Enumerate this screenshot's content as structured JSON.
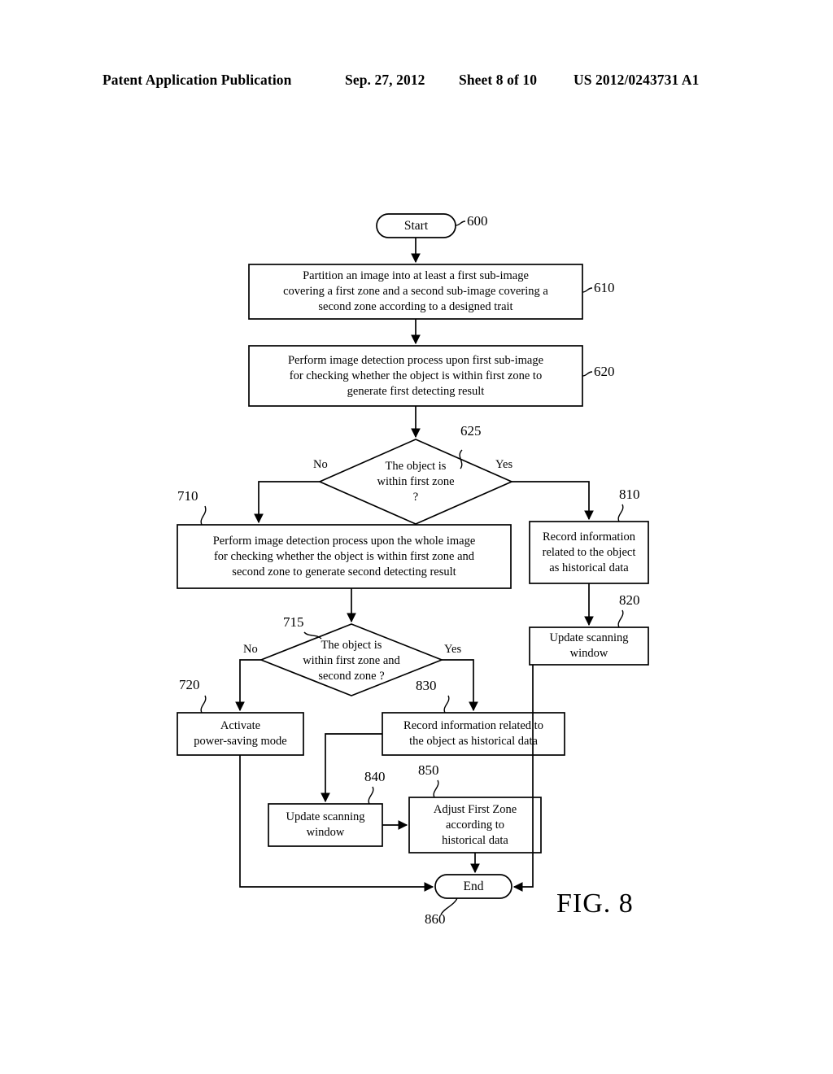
{
  "header": {
    "publication": "Patent Application Publication",
    "date": "Sep. 27, 2012",
    "sheet": "Sheet 8 of 10",
    "patent_number": "US 2012/0243731 A1"
  },
  "figure": {
    "caption": "FIG. 8",
    "nodes": {
      "start": {
        "ref": "600",
        "label": "Start"
      },
      "n610": {
        "ref": "610",
        "label": "Partition an image into at least a first sub-image\ncovering a first zone and a second sub-image covering a\nsecond zone according to a designed trait"
      },
      "n620": {
        "ref": "620",
        "label": "Perform image detection process upon first sub-image\nfor checking whether the object is within first zone to\ngenerate first detecting result"
      },
      "d625": {
        "ref": "625",
        "label": "The object is\nwithin first zone\n?"
      },
      "n710": {
        "ref": "710",
        "label": "Perform image detection process upon the whole image\nfor checking whether the object is within first zone and\nsecond zone to generate second detecting result"
      },
      "n810": {
        "ref": "810",
        "label": "Record information\nrelated to the object\nas historical data"
      },
      "n820": {
        "ref": "820",
        "label": "Update scanning\nwindow"
      },
      "d715": {
        "ref": "715",
        "label": "The object is\nwithin first zone and\nsecond zone ?"
      },
      "n720": {
        "ref": "720",
        "label": "Activate\npower-saving mode"
      },
      "n830": {
        "ref": "830",
        "label": "Record information related to\nthe object as historical data"
      },
      "n840": {
        "ref": "840",
        "label": "Update scanning\nwindow"
      },
      "n850": {
        "ref": "850",
        "label": "Adjust First Zone\naccording to\nhistorical data"
      },
      "end": {
        "ref": "860",
        "label": "End"
      }
    },
    "edge_labels": {
      "d625_no": "No",
      "d625_yes": "Yes",
      "d715_no": "No",
      "d715_yes": "Yes"
    },
    "colors": {
      "stroke": "#000000",
      "background": "#ffffff"
    }
  }
}
